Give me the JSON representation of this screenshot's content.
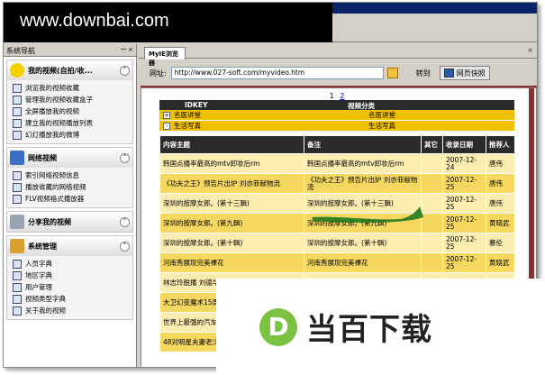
{
  "watermark_top": "www.downbai.com",
  "watermark_bottom": {
    "logo_letter": "D",
    "text": "当百下载"
  },
  "nav": {
    "title": "系统导航",
    "controls": "ꟷ ×",
    "groups": [
      {
        "title": "我的视频(自拍/收...",
        "icon": "lightbulb-icon",
        "items": [
          "浏览我的视频收藏",
          "管理我的视频收藏盒子",
          "全屏播放我的视频",
          "建立我的视频播放列表",
          "幻灯播放我的微博"
        ]
      },
      {
        "title": "网络视频",
        "icon": "film-icon",
        "items": [
          "索引网络视频信息",
          "播放收藏的网络视频",
          "FLV视频格式播放器"
        ]
      },
      {
        "title": "分享我的视频",
        "icon": "server-icon",
        "items": []
      },
      {
        "title": "系统管理",
        "icon": "home-icon",
        "items": [
          "人员字典",
          "地区字典",
          "用户管理",
          "视频类型字典",
          "关于我的视频"
        ]
      }
    ]
  },
  "main": {
    "tab_label": "MyIE浏览器",
    "address_label": "网址:",
    "address_value": "http://www.027-soft.com/myvideo.htm",
    "go_label": "转到",
    "snapshot_label": "网页快照",
    "pager": [
      "1",
      "2"
    ],
    "category_header": {
      "id": "IDKEY",
      "name": "视频分类"
    },
    "categories": [
      {
        "toggle": "+",
        "name": "名医讲堂",
        "value": "名医讲堂"
      },
      {
        "toggle": "-",
        "name": "生活写真",
        "value": "生活写真"
      }
    ],
    "table_headers": [
      "内容主题",
      "备注",
      "其它",
      "收录日期",
      "推荐人"
    ],
    "rows": [
      [
        "韩国点播率最高的mtv卸妆后rm",
        "韩国点播率最高的mtv卸妆后rm",
        "",
        "2007-12-24",
        "唐伟"
      ],
      [
        "《功夫之王》预告片出炉 刘亦菲献物流",
        "《功夫之王》预告片出炉 刘亦菲献物流",
        "",
        "2007-12-25",
        "唐伟"
      ],
      [
        "深圳的按摩女郎。(第十三輯)",
        "深圳的按摩女郎。(第十三輯)",
        "",
        "2007-12-25",
        "唐伟"
      ],
      [
        "深圳的按摩女郎。(第九輯)",
        "深圳的按摩女郎。(第九輯)",
        "",
        "2007-12-25",
        "黄晓武"
      ],
      [
        "深圳的按摩女郎。(第十輯)",
        "深圳的按摩女郎。(第十輯)",
        "",
        "2007-12-25",
        "慕伦"
      ],
      [
        "河南秀展现完美裸花",
        "河南秀展现完美裸花",
        "",
        "2007-12-25",
        "黄晓武"
      ],
      [
        "林志玲脱播 刘德华",
        "",
        "",
        "",
        ""
      ],
      [
        "大卫幻变魔术15周",
        "",
        "",
        "",
        ""
      ],
      [
        "世界上最强的汽车",
        "",
        "",
        "",
        ""
      ],
      [
        "48对明星夫妻老少",
        "",
        "",
        "",
        ""
      ]
    ]
  }
}
